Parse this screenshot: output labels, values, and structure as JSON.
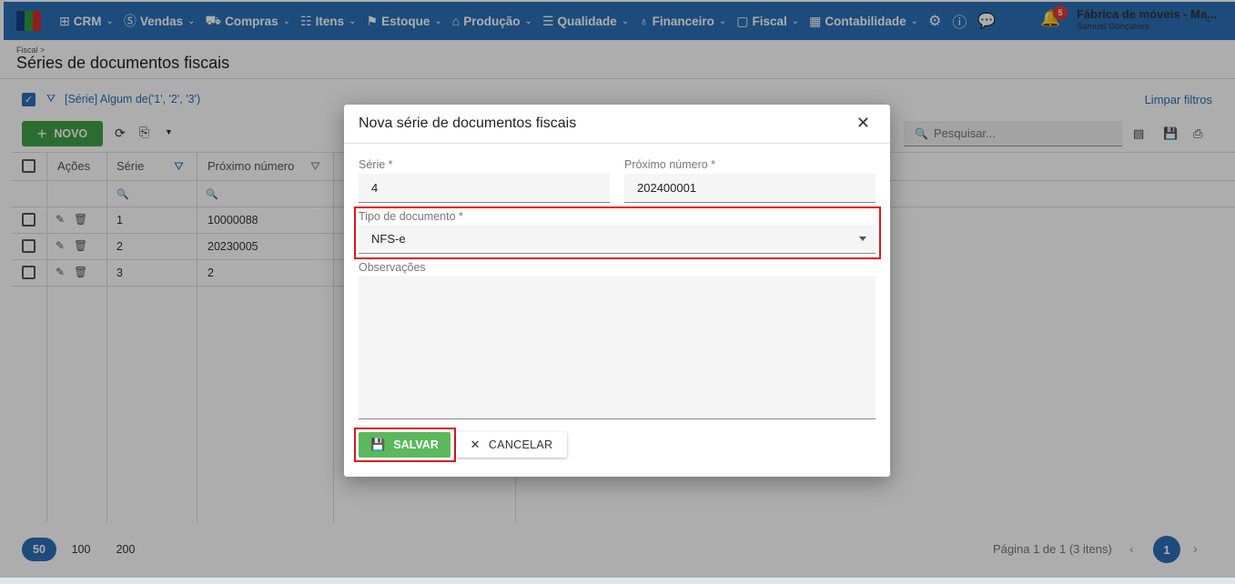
{
  "nav": {
    "items": [
      {
        "label": "CRM",
        "icon": "crm-icon",
        "glyph": "⊞"
      },
      {
        "label": "Vendas",
        "icon": "dollar-icon",
        "glyph": "Ⓢ"
      },
      {
        "label": "Compras",
        "icon": "cart-icon",
        "glyph": "🛒"
      },
      {
        "label": "Itens",
        "icon": "items-icon",
        "glyph": "☷"
      },
      {
        "label": "Estoque",
        "icon": "stock-icon",
        "glyph": "⚑"
      },
      {
        "label": "Produção",
        "icon": "factory-icon",
        "glyph": "⌂"
      },
      {
        "label": "Qualidade",
        "icon": "quality-icon",
        "glyph": "☰"
      },
      {
        "label": "Financeiro",
        "icon": "money-bag-icon",
        "glyph": "♁"
      },
      {
        "label": "Fiscal",
        "icon": "document-icon",
        "glyph": "▢"
      },
      {
        "label": "Contabilidade",
        "icon": "calculator-icon",
        "glyph": "▦"
      }
    ],
    "notifications_count": "5",
    "company": "Fábrica de móveis - Ma...",
    "user": "Samuel Gonçalves"
  },
  "page": {
    "breadcrumb": "Fiscal >",
    "title": "Séries de documentos fiscais",
    "filter_text": "[Série] Algum de('1', '2', '3')",
    "clear_filters": "Limpar filtros",
    "new_button": "NOVO",
    "search_placeholder": "Pesquisar..."
  },
  "table": {
    "headers": {
      "actions": "Ações",
      "serie": "Série",
      "next_number": "Próximo número"
    },
    "rows": [
      {
        "serie": "1",
        "next_number": "10000088"
      },
      {
        "serie": "2",
        "next_number": "20230005"
      },
      {
        "serie": "3",
        "next_number": "2"
      }
    ]
  },
  "pager": {
    "sizes": [
      "50",
      "100",
      "200"
    ],
    "active_size": "50",
    "info": "Página 1 de 1 (3 itens)",
    "current_page": "1"
  },
  "modal": {
    "title": "Nova série de documentos fiscais",
    "serie_label": "Série *",
    "serie_value": "4",
    "next_number_label": "Próximo número *",
    "next_number_value": "202400001",
    "doc_type_label": "Tipo de documento *",
    "doc_type_value": "NFS-e",
    "notes_label": "Observações",
    "save_label": "SALVAR",
    "cancel_label": "CANCELAR"
  },
  "colors": {
    "primary": "#2c6fb7",
    "save_green": "#5cb85c",
    "new_green": "#43a047",
    "highlight_red": "#e0161b"
  }
}
